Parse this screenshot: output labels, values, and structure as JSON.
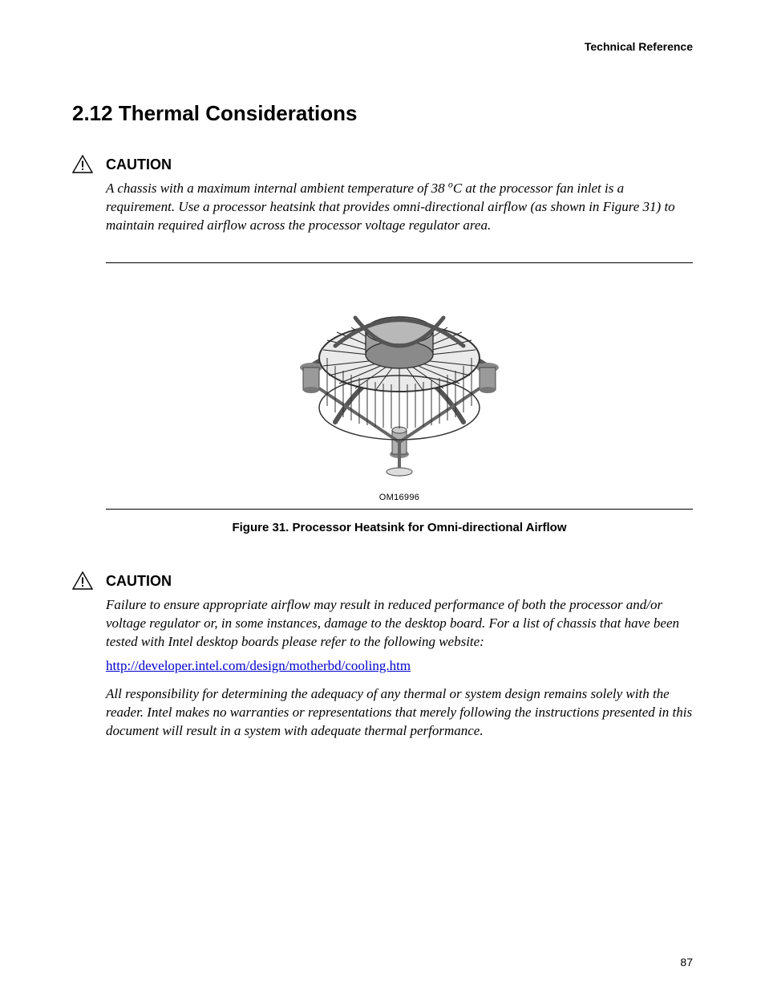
{
  "header": {
    "running": "Technical Reference"
  },
  "section": {
    "number_title": "2.12  Thermal Considerations"
  },
  "caution1": {
    "label": "CAUTION",
    "text_pre": "A chassis with a maximum internal ambient temperature of 38 ",
    "text_sup": "o",
    "text_post": "C at the processor fan inlet is a requirement.  Use a processor heatsink that provides omni-directional airflow (as shown in Figure 31) to maintain required airflow across the processor voltage regulator area."
  },
  "figure": {
    "id": "OM16996",
    "caption": "Figure 31.  Processor Heatsink for Omni-directional Airflow"
  },
  "caution2": {
    "label": "CAUTION",
    "para1": "Failure to ensure appropriate airflow may result in reduced performance of both the processor and/or voltage regulator or, in some instances, damage to the desktop board.  For a list of chassis that have been tested with Intel desktop boards please refer to the following website:",
    "link_text": "http://developer.intel.com/design/motherbd/cooling.htm",
    "link_href": "http://developer.intel.com/design/motherbd/cooling.htm",
    "para2": "All responsibility for determining the adequacy of any thermal or system design remains solely with the reader.  Intel makes no warranties or representations that merely following the instructions presented in this document will result in a system with adequate thermal performance."
  },
  "page_number": "87"
}
